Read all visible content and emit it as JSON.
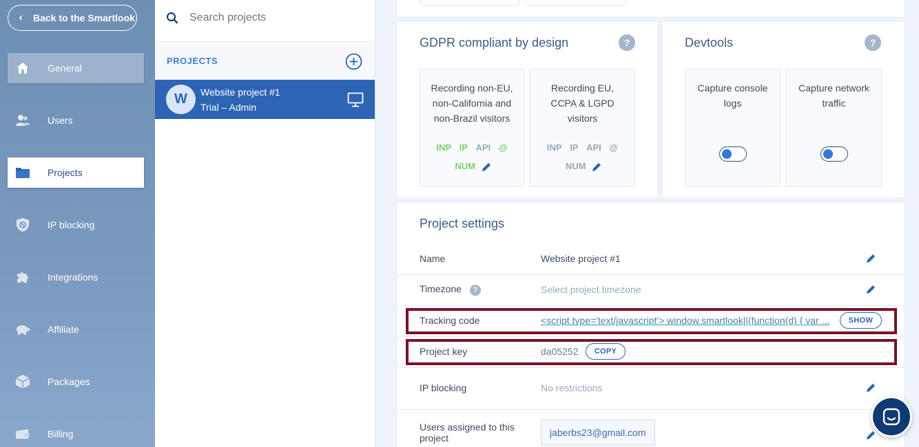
{
  "sidebar": {
    "back_label": "Back to the Smartlook",
    "items": [
      {
        "label": "General",
        "icon": "home-icon"
      },
      {
        "label": "Users",
        "icon": "users-icon"
      },
      {
        "label": "Projects",
        "icon": "folder-icon"
      },
      {
        "label": "IP blocking",
        "icon": "shield-block-icon"
      },
      {
        "label": "Integrations",
        "icon": "puzzle-icon"
      },
      {
        "label": "Affiliate",
        "icon": "turtle-icon"
      },
      {
        "label": "Packages",
        "icon": "package-icon"
      },
      {
        "label": "Billing",
        "icon": "wallet-icon"
      }
    ]
  },
  "projects_panel": {
    "search_placeholder": "Search projects",
    "header": "PROJECTS",
    "project": {
      "initial": "W",
      "name": "Website project #1",
      "subtitle": "Trial – Admin"
    }
  },
  "gdpr": {
    "title": "GDPR compliant by design",
    "help": "?",
    "options": [
      {
        "lines": [
          "Recording non-EU,",
          "non-California and",
          "non-Brazil visitors"
        ],
        "tags_line1": [
          "INP",
          "IP",
          "API",
          "@"
        ],
        "tags_line2": [
          "NUM"
        ]
      },
      {
        "lines": [
          "Recording EU,",
          "CCPA & LGPD",
          "visitors"
        ],
        "tags_line1": [
          "INP",
          "IP",
          "API",
          "@"
        ],
        "tags_line2": [
          "NUM"
        ]
      }
    ]
  },
  "devtools": {
    "title": "Devtools",
    "help": "?",
    "options": [
      {
        "lines": [
          "Capture console",
          "logs"
        ]
      },
      {
        "lines": [
          "Capture network",
          "traffic"
        ]
      }
    ]
  },
  "settings": {
    "title": "Project settings",
    "name_label": "Name",
    "name_value": "Website project #1",
    "timezone_label": "Timezone",
    "timezone_help": "?",
    "timezone_value": "Select project timezone",
    "tracking_label": "Tracking code",
    "tracking_value": "<script type='text/javascript'> window.smartlook||(function(d) { var ...",
    "show_label": "SHOW",
    "key_label": "Project key",
    "key_value": "da05252",
    "copy_label": "COPY",
    "ip_label": "IP blocking",
    "ip_value": "No restrictions",
    "users_label_1": "Users assigned to this",
    "users_label_2": "project",
    "users_value": "jaberbs23@gmail.com"
  },
  "colors": {
    "primary": "#2d64b3",
    "highlight_border": "#7a1326",
    "tag_on": "#7fd06a",
    "tag_off": "#99a9bd"
  }
}
